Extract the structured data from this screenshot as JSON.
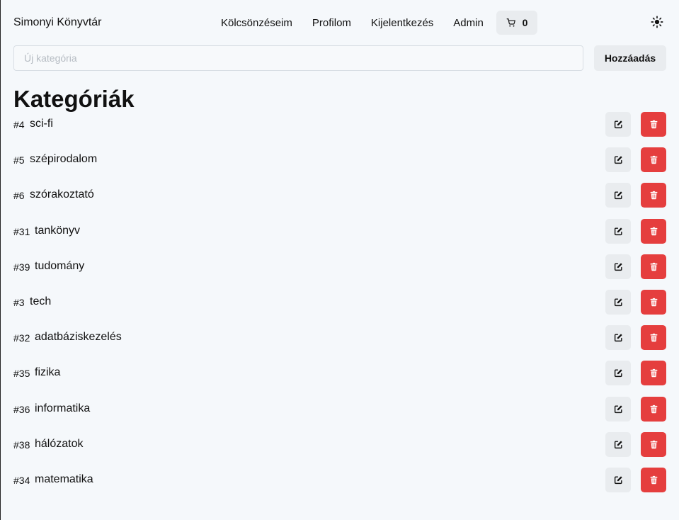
{
  "header": {
    "brand": "Simonyi Könyvtár",
    "nav": [
      {
        "label": "Kölcsönzéseim"
      },
      {
        "label": "Profilom"
      },
      {
        "label": "Kijelentkezés"
      },
      {
        "label": "Admin"
      }
    ],
    "cart_count": "0",
    "cart_icon": "shopping-cart-icon",
    "theme_icon": "sun-icon"
  },
  "add_form": {
    "placeholder": "Új kategória",
    "value": "",
    "button_label": "Hozzáadás"
  },
  "page_title": "Kategóriák",
  "categories": [
    {
      "id": "#4",
      "name": "sci-fi"
    },
    {
      "id": "#5",
      "name": "szépirodalom"
    },
    {
      "id": "#6",
      "name": "szórakoztató"
    },
    {
      "id": "#31",
      "name": "tankönyv"
    },
    {
      "id": "#39",
      "name": "tudomány"
    },
    {
      "id": "#3",
      "name": "tech"
    },
    {
      "id": "#32",
      "name": "adatbáziskezelés"
    },
    {
      "id": "#35",
      "name": "fizika"
    },
    {
      "id": "#36",
      "name": "informatika"
    },
    {
      "id": "#38",
      "name": "hálózatok"
    },
    {
      "id": "#34",
      "name": "matematika"
    }
  ],
  "icons": {
    "edit": "edit-icon",
    "delete": "trash-icon"
  },
  "colors": {
    "background": "#f5f8fb",
    "button_gray": "#e9ecef",
    "danger": "#e53e3e"
  }
}
